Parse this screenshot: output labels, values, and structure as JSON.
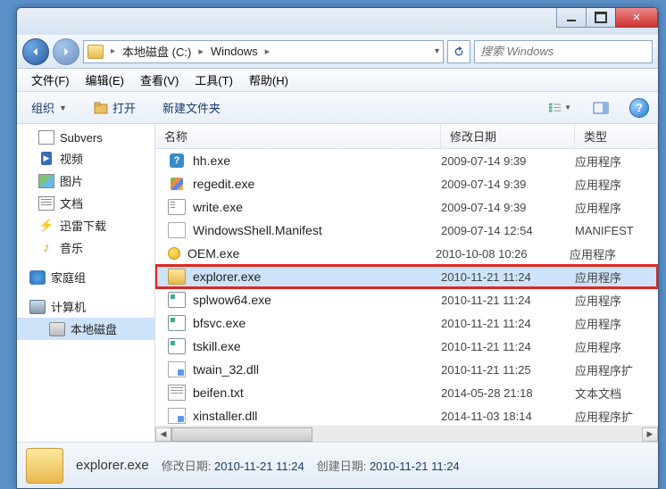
{
  "breadcrumb": {
    "drive": "本地磁盘 (C:)",
    "folder": "Windows"
  },
  "search": {
    "placeholder": "搜索 Windows"
  },
  "menu": {
    "file": "文件(F)",
    "edit": "编辑(E)",
    "view": "查看(V)",
    "tools": "工具(T)",
    "help": "帮助(H)"
  },
  "toolbar": {
    "organize": "组织",
    "open": "打开",
    "newfolder": "新建文件夹"
  },
  "sidebar": {
    "subversion": "Subvers",
    "video": "视频",
    "pictures": "图片",
    "documents": "文档",
    "thunder": "迅雷下载",
    "music": "音乐",
    "homegroup": "家庭组",
    "computer": "计算机",
    "localdisk": "本地磁盘"
  },
  "columns": {
    "name": "名称",
    "date": "修改日期",
    "type": "类型"
  },
  "files": [
    {
      "icon": "hh",
      "name": "hh.exe",
      "date": "2009-07-14 9:39",
      "type": "应用程序"
    },
    {
      "icon": "reg",
      "name": "regedit.exe",
      "date": "2009-07-14 9:39",
      "type": "应用程序"
    },
    {
      "icon": "write",
      "name": "write.exe",
      "date": "2009-07-14 9:39",
      "type": "应用程序"
    },
    {
      "icon": "manifest",
      "name": "WindowsShell.Manifest",
      "date": "2009-07-14 12:54",
      "type": "MANIFEST"
    },
    {
      "icon": "oem",
      "name": "OEM.exe",
      "date": "2010-10-08 10:26",
      "type": "应用程序"
    },
    {
      "icon": "explorer",
      "name": "explorer.exe",
      "date": "2010-11-21 11:24",
      "type": "应用程序",
      "highlighted": true,
      "selected": true
    },
    {
      "icon": "exe",
      "name": "splwow64.exe",
      "date": "2010-11-21 11:24",
      "type": "应用程序"
    },
    {
      "icon": "exe",
      "name": "bfsvc.exe",
      "date": "2010-11-21 11:24",
      "type": "应用程序"
    },
    {
      "icon": "exe",
      "name": "tskill.exe",
      "date": "2010-11-21 11:24",
      "type": "应用程序"
    },
    {
      "icon": "dll",
      "name": "twain_32.dll",
      "date": "2010-11-21 11:25",
      "type": "应用程序扩"
    },
    {
      "icon": "txt",
      "name": "beifen.txt",
      "date": "2014-05-28 21:18",
      "type": "文本文档"
    },
    {
      "icon": "dll",
      "name": "xinstaller.dll",
      "date": "2014-11-03 18:14",
      "type": "应用程序扩"
    }
  ],
  "status": {
    "filename": "explorer.exe",
    "modlabel": "修改日期:",
    "moddate": "2010-11-21 11:24",
    "createlabel": "创建日期:",
    "createdate": "2010-11-21 11:24"
  }
}
